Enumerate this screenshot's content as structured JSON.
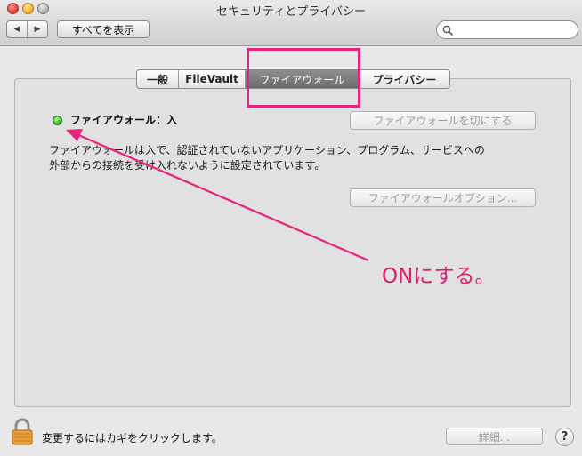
{
  "window": {
    "title": "セキュリティとプライバシー"
  },
  "toolbar": {
    "back_glyph": "◀",
    "forward_glyph": "▶",
    "show_all_label": "すべてを表示",
    "search_placeholder": "",
    "search_icon": "magnifier-icon"
  },
  "tabs": [
    {
      "label": "一般",
      "selected": false
    },
    {
      "label": "FileVault",
      "selected": false
    },
    {
      "label": "ファイアウォール",
      "selected": true
    },
    {
      "label": "プライバシー",
      "selected": false
    }
  ],
  "firewall": {
    "status_label": "ファイアウォール：入",
    "status_color": "#3fbd2a",
    "turn_off_button": "ファイアウォールを切にする",
    "description_line1": "ファイアウォールは入で、認証されていないアプリケーション、プログラム、サービスへの",
    "description_line2": "外部からの接続を受け入れないように設定されています。",
    "options_button": "ファイアウォールオプション..."
  },
  "footer": {
    "lock_icon": "padlock-icon",
    "lock_text": "変更するにはカギをクリックします。",
    "details_button": "詳細...",
    "help_glyph": "?"
  },
  "annotation": {
    "text": "ONにする。",
    "color": "#e6237a"
  }
}
